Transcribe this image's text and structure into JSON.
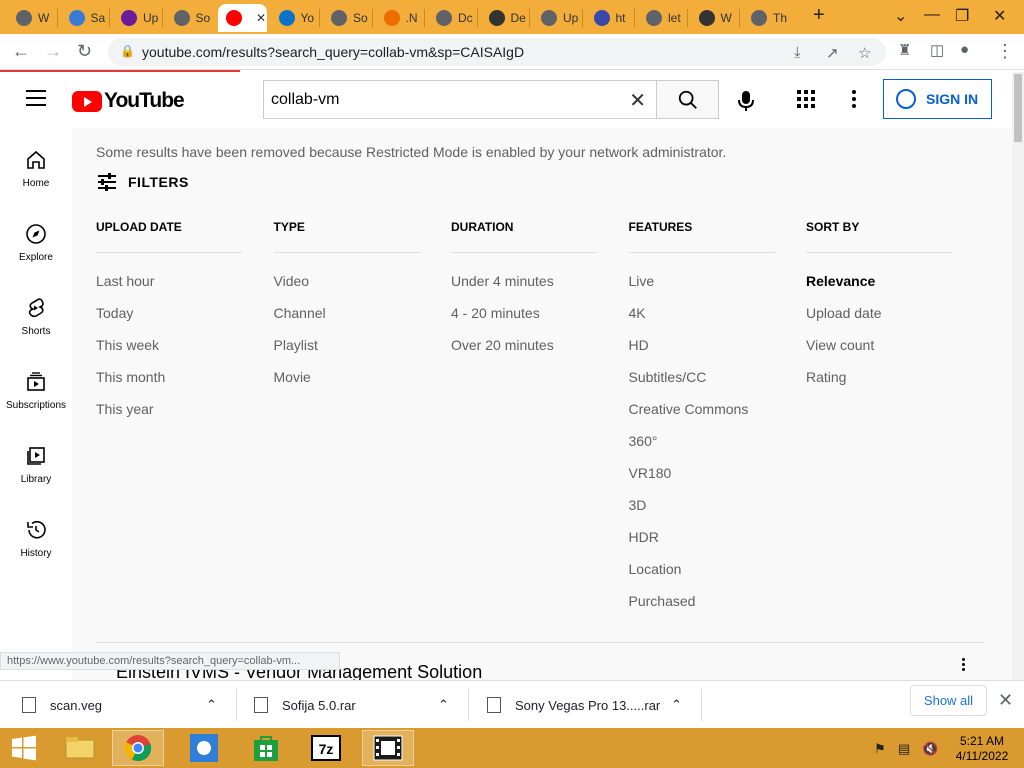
{
  "browser": {
    "tabs": [
      {
        "label": "W",
        "color": "#5f6368"
      },
      {
        "label": "Sa",
        "color": "#3a7bd5"
      },
      {
        "label": "Up",
        "color": "#6a1b9a"
      },
      {
        "label": "So",
        "color": "#5f6368"
      },
      {
        "label": "",
        "color": "#ff0000"
      },
      {
        "label": "Yo",
        "color": "#0a73c9"
      },
      {
        "label": "So",
        "color": "#5f6368"
      },
      {
        "label": ".N",
        "color": "#ef6c00"
      },
      {
        "label": "Dc",
        "color": "#5f6368"
      },
      {
        "label": "De",
        "color": "#333333"
      },
      {
        "label": "Up",
        "color": "#5f6368"
      },
      {
        "label": "ht",
        "color": "#3949ab"
      },
      {
        "label": "let",
        "color": "#5f6368"
      },
      {
        "label": "W",
        "color": "#333333"
      },
      {
        "label": "Th",
        "color": "#5f6368"
      }
    ],
    "new_tab": "+",
    "url": "youtube.com/results?search_query=collab-vm&sp=CAISAIgD",
    "status_url": "https://www.youtube.com/results?search_query=collab-vm..."
  },
  "youtube": {
    "logo_text": "YouTube",
    "search_query": "collab-vm",
    "sign_in": "SIGN IN",
    "sidebar": [
      {
        "label": "Home",
        "icon": "home-icon"
      },
      {
        "label": "Explore",
        "icon": "compass-icon"
      },
      {
        "label": "Shorts",
        "icon": "shorts-icon"
      },
      {
        "label": "Subscriptions",
        "icon": "subscriptions-icon"
      },
      {
        "label": "Library",
        "icon": "library-icon"
      },
      {
        "label": "History",
        "icon": "history-icon"
      }
    ],
    "notice": "Some results have been removed because Restricted Mode is enabled by your network administrator.",
    "filters_label": "FILTERS",
    "filter_columns": [
      {
        "heading": "UPLOAD DATE",
        "options": [
          "Last hour",
          "Today",
          "This week",
          "This month",
          "This year"
        ]
      },
      {
        "heading": "TYPE",
        "options": [
          "Video",
          "Channel",
          "Playlist",
          "Movie"
        ]
      },
      {
        "heading": "DURATION",
        "options": [
          "Under 4 minutes",
          "4 - 20 minutes",
          "Over 20 minutes"
        ]
      },
      {
        "heading": "FEATURES",
        "options": [
          "Live",
          "4K",
          "HD",
          "Subtitles/CC",
          "Creative Commons",
          "360°",
          "VR180",
          "3D",
          "HDR",
          "Location",
          "Purchased"
        ]
      },
      {
        "heading": "SORT BY",
        "options": [
          "Relevance",
          "Upload date",
          "View count",
          "Rating"
        ],
        "selected": "Relevance"
      }
    ],
    "partial_result_title": "Einstein IVMS - Vendor Management Solution"
  },
  "downloads": {
    "items": [
      "scan.veg",
      "Sofija 5.0.rar",
      "Sony Vegas Pro 13.....rar"
    ],
    "show_all": "Show all"
  },
  "taskbar": {
    "time": "5:21 AM",
    "date": "4/11/2022"
  }
}
